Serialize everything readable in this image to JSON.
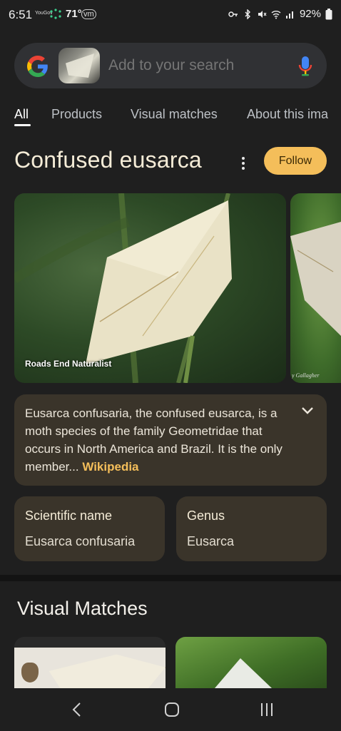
{
  "status_bar": {
    "time": "6:51",
    "small_app": "YouGov",
    "temperature": "71°",
    "vm_badge": "vm",
    "battery": "92%"
  },
  "search": {
    "placeholder": "Add to your search",
    "logo_icon": "google-g-icon",
    "mic_icon": "mic-icon"
  },
  "tabs": [
    {
      "label": "All"
    },
    {
      "label": "Products"
    },
    {
      "label": "Visual matches"
    },
    {
      "label": "About this ima"
    }
  ],
  "entity": {
    "title": "Confused eusarca",
    "follow_label": "Follow",
    "accent_color": "#f4be5a"
  },
  "images": [
    {
      "caption": "Roads End Naturalist"
    },
    {
      "caption": "y Gallagher"
    }
  ],
  "description": {
    "text": "Eusarca confusaria, the confused eusarca, is a moth species of the family Geometridae that occurs in North America and Brazil. It is the only member... ",
    "link": "Wikipedia"
  },
  "facts": [
    {
      "label": "Scientific name",
      "value": "Eusarca confusaria"
    },
    {
      "label": "Genus",
      "value": "Eusarca"
    }
  ],
  "visual_matches": {
    "title": "Visual Matches"
  },
  "nav": {
    "back_icon": "back-icon",
    "home_icon": "home-icon",
    "recents_icon": "recents-icon"
  }
}
